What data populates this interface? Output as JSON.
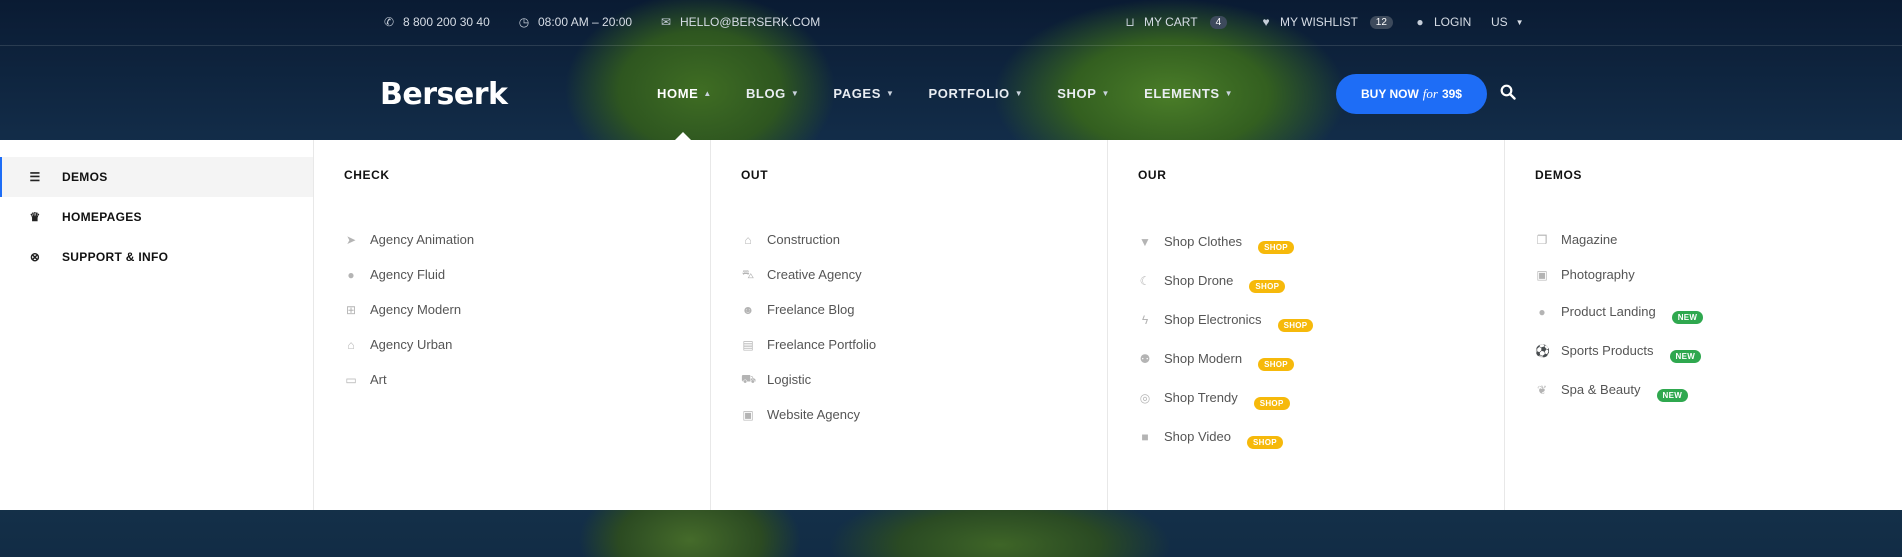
{
  "topbar": {
    "phone": "8 800 200 30 40",
    "hours": "08:00 AM – 20:00",
    "email": "HELLO@BERSERK.COM",
    "cart_label": "MY CART",
    "cart_count": "4",
    "wishlist_label": "MY WISHLIST",
    "wishlist_count": "12",
    "login_label": "LOGIN",
    "language": "US"
  },
  "header": {
    "logo": "Berserk",
    "nav": [
      "HOME",
      "BLOG",
      "PAGES",
      "PORTFOLIO",
      "SHOP",
      "ELEMENTS"
    ],
    "buy_label": "BUY NOW",
    "buy_for": "for",
    "buy_price": "39$"
  },
  "sidebar": {
    "items": [
      {
        "label": "DEMOS",
        "icon": "list-icon"
      },
      {
        "label": "HOMEPAGES",
        "icon": "trophy-icon"
      },
      {
        "label": "SUPPORT & INFO",
        "icon": "lifebuoy-icon"
      }
    ]
  },
  "columns": [
    {
      "title": "CHECK",
      "links": [
        {
          "label": "Agency Animation",
          "icon": "paper-plane-icon"
        },
        {
          "label": "Agency Fluid",
          "icon": "droplet-icon"
        },
        {
          "label": "Agency Modern",
          "icon": "gift-icon"
        },
        {
          "label": "Agency Urban",
          "icon": "bank-icon"
        },
        {
          "label": "Art",
          "icon": "card-icon"
        }
      ]
    },
    {
      "title": "OUT",
      "links": [
        {
          "label": "Construction",
          "icon": "home-icon"
        },
        {
          "label": "Creative Agency",
          "icon": "car-icon"
        },
        {
          "label": "Freelance Blog",
          "icon": "users-icon"
        },
        {
          "label": "Freelance Portfolio",
          "icon": "document-icon"
        },
        {
          "label": "Logistic",
          "icon": "truck-icon"
        },
        {
          "label": "Website Agency",
          "icon": "images-icon"
        }
      ]
    },
    {
      "title": "OUR",
      "links": [
        {
          "label": "Shop Clothes",
          "icon": "tshirt-icon",
          "tag": "SHOP"
        },
        {
          "label": "Shop Drone",
          "icon": "moon-icon",
          "tag": "SHOP"
        },
        {
          "label": "Shop Electronics",
          "icon": "bolt-icon",
          "tag": "SHOP"
        },
        {
          "label": "Shop Modern",
          "icon": "space-invader-icon",
          "tag": "SHOP"
        },
        {
          "label": "Shop Trendy",
          "icon": "dribbble-icon",
          "tag": "SHOP"
        },
        {
          "label": "Shop Video",
          "icon": "video-camera-icon",
          "tag": "SHOP"
        }
      ]
    },
    {
      "title": "DEMOS",
      "links": [
        {
          "label": "Magazine",
          "icon": "copy-icon"
        },
        {
          "label": "Photography",
          "icon": "camera-icon"
        },
        {
          "label": "Product Landing",
          "icon": "product-icon",
          "tag": "NEW"
        },
        {
          "label": "Sports Products",
          "icon": "soccer-ball-icon",
          "tag": "NEW"
        },
        {
          "label": "Spa & Beauty",
          "icon": "leaf-icon",
          "tag": "NEW"
        }
      ]
    }
  ]
}
